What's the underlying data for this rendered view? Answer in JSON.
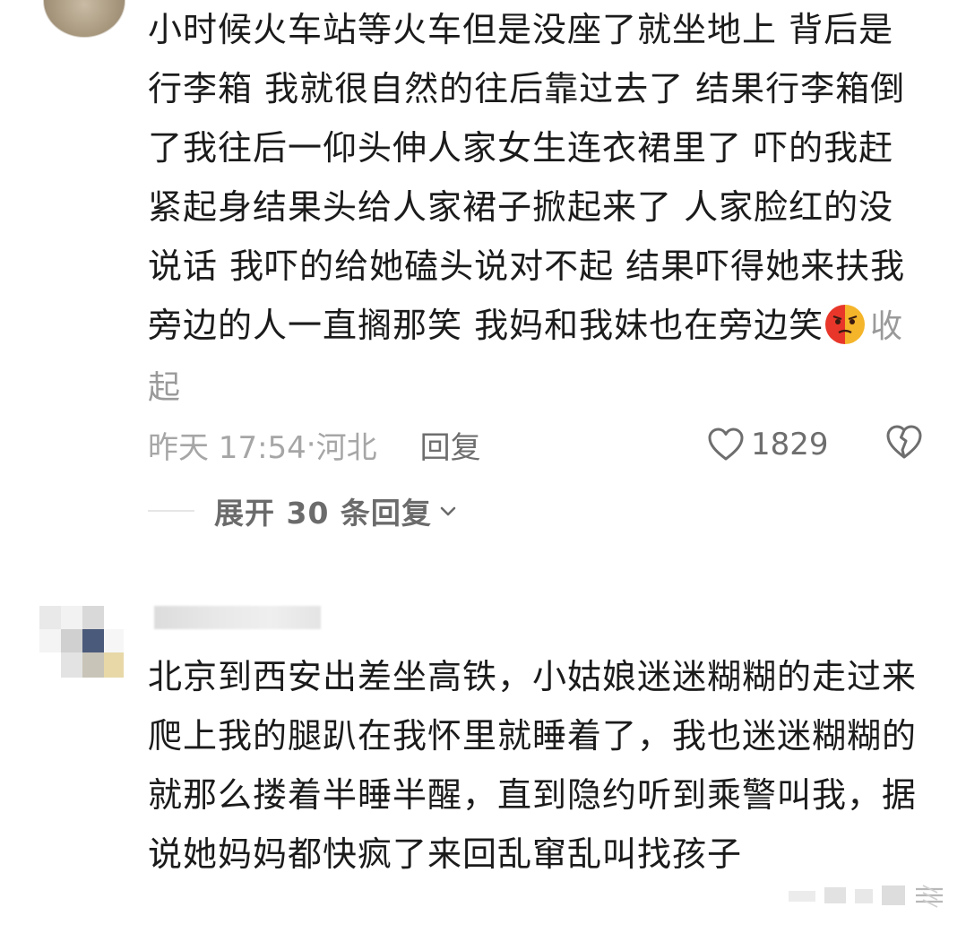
{
  "comment1": {
    "text": "小时候火车站等火车但是没座了就坐地上 背后是行李箱 我就很自然的往后靠过去了 结果行李箱倒了我往后一仰头伸人家女生连衣裙里了 吓的我赶紧起身结果头给人家裙子掀起来了 人家脸红的没说话 我吓的给她磕头说对不起 结果吓得她来扶我 旁边的人一直搁那笑 我妈和我妹也在旁边笑",
    "emoji": "embarrassed-face-emoji",
    "collapse_label": "收起",
    "timestamp": "昨天 17:54",
    "separator": "·",
    "location": "河北",
    "reply_label": "回复",
    "like_count": "1829",
    "expand_replies_label": "展开 30 条回复"
  },
  "comment2": {
    "text": "北京到西安出差坐高铁，小姑娘迷迷糊糊的走过来爬上我的腿趴在我怀里就睡着了，我也迷迷糊糊的就那么搂着半睡半醒，直到隐约听到乘警叫我，据说她妈妈都快疯了来回乱窜乱叫找孩子"
  },
  "colors": {
    "text_primary": "#1b1b1b",
    "text_secondary": "#a6a6a6",
    "text_muted": "#6e6e6e",
    "background": "#ffffff"
  },
  "icons": {
    "like": "heart-outline-icon",
    "dislike": "broken-heart-outline-icon",
    "expand": "chevron-down-icon"
  }
}
